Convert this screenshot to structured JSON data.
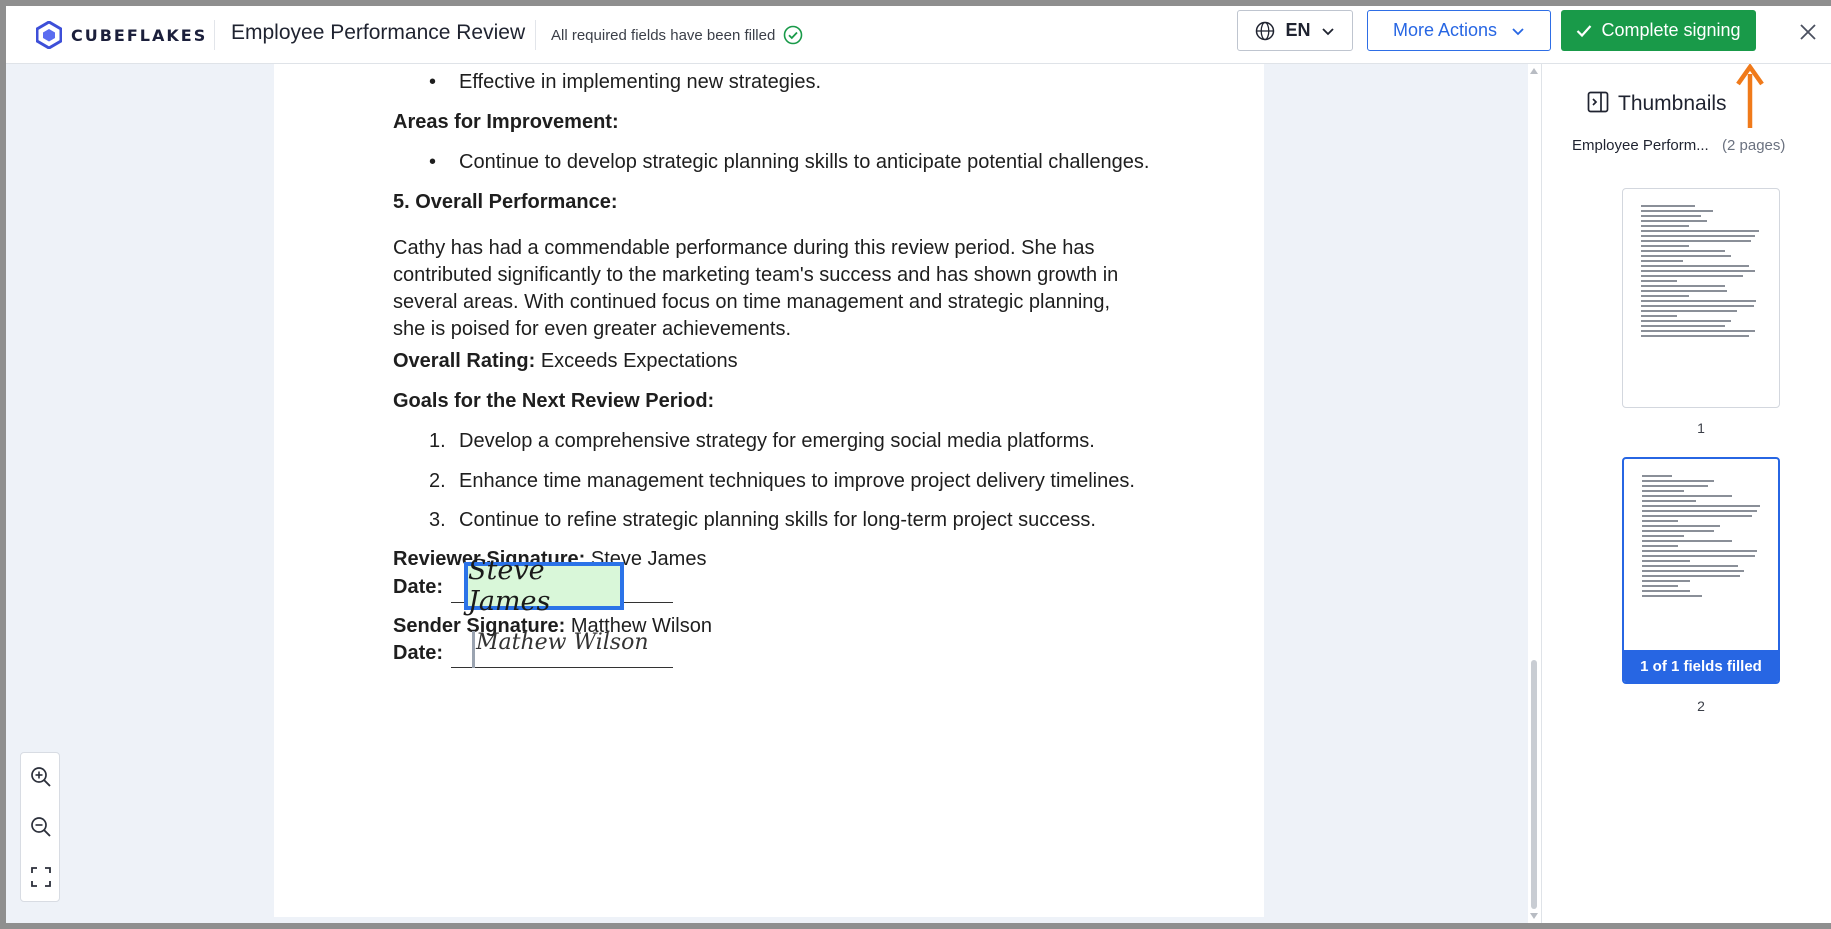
{
  "header": {
    "logo_text": "CUBEFLAKES",
    "title": "Employee Performance Review",
    "status_text": "All required fields have been filled",
    "language": "EN",
    "more_actions_label": "More Actions",
    "complete_label": "Complete signing"
  },
  "document": {
    "bullet_top": "Effective in implementing new strategies.",
    "areas_heading": "Areas for Improvement:",
    "areas_bullet": "Continue to develop strategic planning skills to anticipate potential challenges.",
    "overall_heading": "5. Overall Performance:",
    "overall_para": "Cathy has had a commendable performance during this review period. She has contributed significantly to the marketing team's success and has shown growth in several areas. With continued focus on time management and strategic planning, she is poised for even greater achievements.",
    "rating_label": "Overall Rating:",
    "rating_value": "Exceeds Expectations",
    "goals_heading": "Goals for the Next Review Period:",
    "goals": [
      {
        "num": "1.",
        "text": "Develop a comprehensive strategy for emerging social media platforms."
      },
      {
        "num": "2.",
        "text": "Enhance time management techniques to improve project delivery timelines."
      },
      {
        "num": "3.",
        "text": "Continue to refine strategic planning skills for long-term project success."
      }
    ],
    "reviewer_label": "Reviewer Signature:",
    "reviewer_name": "Steve James",
    "date_label": "Date:",
    "reviewer_sig": "Steve James",
    "sender_label": "Sender Signature:",
    "sender_name": "Matthew Wilson",
    "sender_sig": "Mathew Wilson"
  },
  "sidebar": {
    "title": "Thumbnails",
    "doc_name": "Employee Perform...",
    "pages_count": "(2 pages)",
    "thumbs": [
      {
        "page": "1"
      },
      {
        "page": "2",
        "badge": "1 of 1 fields filled"
      }
    ]
  },
  "colors": {
    "accent": "#2766e3",
    "success": "#199a49",
    "annotation": "#f07a1a"
  }
}
